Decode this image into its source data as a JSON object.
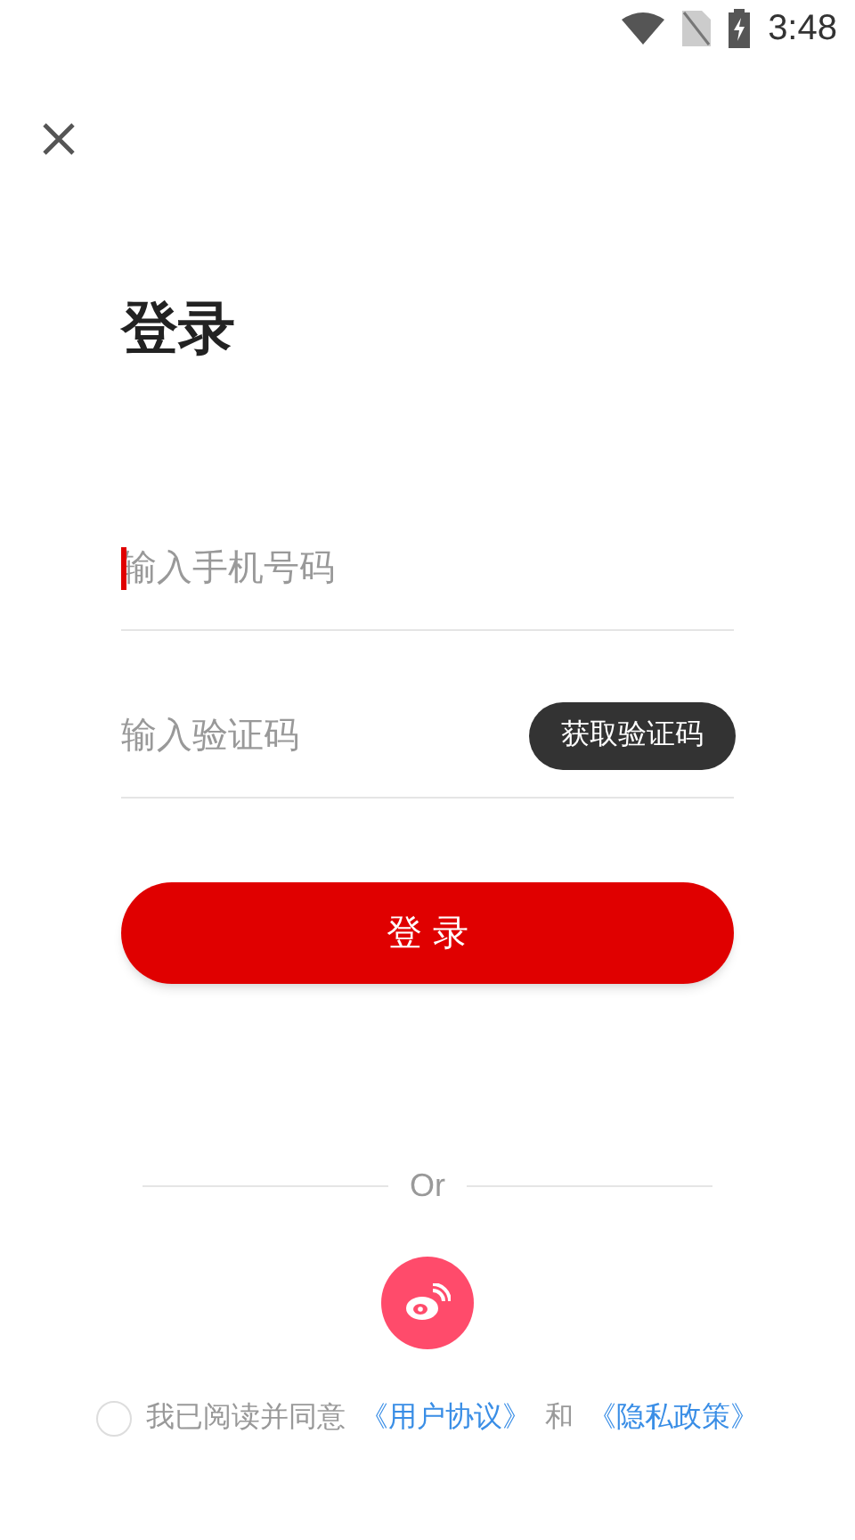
{
  "status_bar": {
    "time": "3:48"
  },
  "title": "登录",
  "phone_field": {
    "placeholder": "输入手机号码",
    "focused": true
  },
  "code_field": {
    "placeholder": "输入验证码",
    "button": "获取验证码"
  },
  "login_button": "登 录",
  "divider_text": "Or",
  "agreement": {
    "checked": false,
    "text": "我已阅读并同意",
    "link_1": "《用户协议》",
    "conjunction": "和",
    "link_2": "《隐私政策》"
  }
}
